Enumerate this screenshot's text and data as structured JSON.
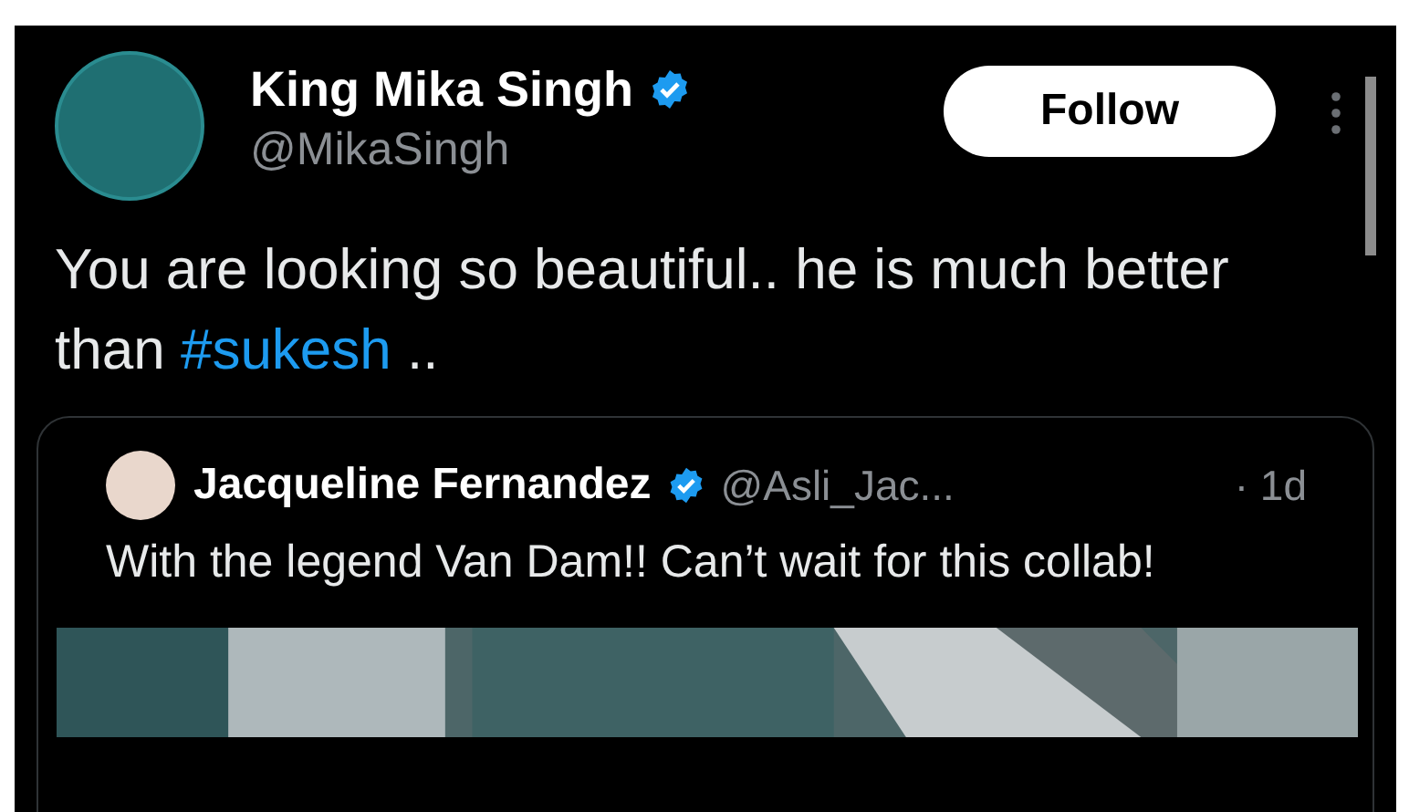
{
  "tweet": {
    "author": {
      "name": "King Mika Singh",
      "verified": true,
      "handle": "@MikaSingh"
    },
    "follow_button": "Follow",
    "text": "You are looking so beautiful.. he is much better than ",
    "hashtag": "#sukesh",
    "text_after": " ..",
    "quoted": {
      "author": {
        "name": "Jacqueline Fernandez",
        "verified": true,
        "handle": "@Asli_Jac...",
        "time": "· 1d"
      },
      "text": "With the legend Van Dam!! Can’t wait for this collab!"
    }
  }
}
